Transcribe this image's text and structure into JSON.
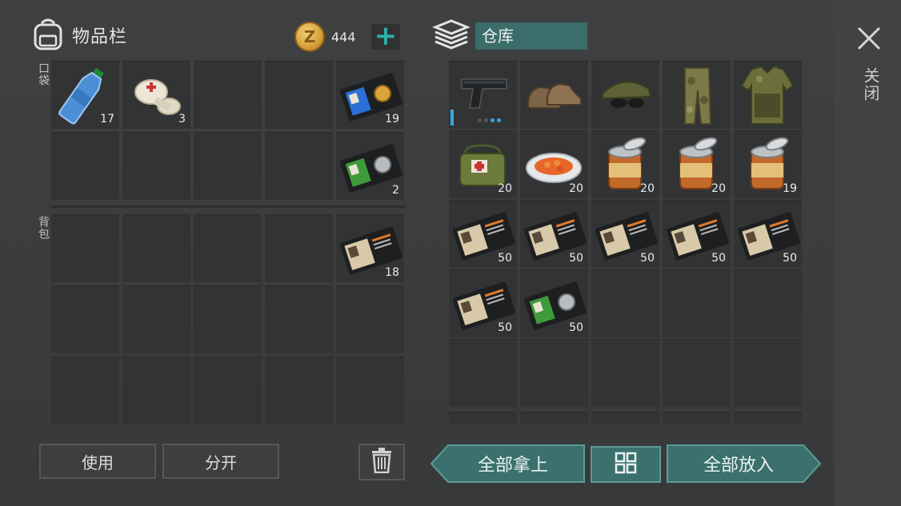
{
  "inventory": {
    "title": "物品栏",
    "coins": "444",
    "add_icon": "plus-icon",
    "pocket_label": "口袋",
    "backpack_label": "背包"
  },
  "storage": {
    "title": "仓库"
  },
  "pocket_slots": [
    {
      "icon": "water-bottle",
      "qty": "17"
    },
    {
      "icon": "bandage",
      "qty": "3"
    },
    {
      "icon": "",
      "qty": ""
    },
    {
      "icon": "",
      "qty": ""
    },
    {
      "icon": "police-badge-blue",
      "qty": "19"
    },
    {
      "icon": "",
      "qty": ""
    },
    {
      "icon": "",
      "qty": ""
    },
    {
      "icon": "",
      "qty": ""
    },
    {
      "icon": "",
      "qty": ""
    },
    {
      "icon": "police-badge-green",
      "qty": "2"
    }
  ],
  "backpack_slots": [
    {
      "icon": "",
      "qty": ""
    },
    {
      "icon": "",
      "qty": ""
    },
    {
      "icon": "",
      "qty": ""
    },
    {
      "icon": "",
      "qty": ""
    },
    {
      "icon": "patrol-officer-id",
      "qty": "18"
    },
    {
      "icon": "",
      "qty": ""
    },
    {
      "icon": "",
      "qty": ""
    },
    {
      "icon": "",
      "qty": ""
    },
    {
      "icon": "",
      "qty": ""
    },
    {
      "icon": "",
      "qty": ""
    },
    {
      "icon": "",
      "qty": ""
    },
    {
      "icon": "",
      "qty": ""
    },
    {
      "icon": "",
      "qty": ""
    },
    {
      "icon": "",
      "qty": ""
    },
    {
      "icon": "",
      "qty": ""
    }
  ],
  "storage_slots": [
    {
      "icon": "pistol",
      "qty": ""
    },
    {
      "icon": "boots",
      "qty": ""
    },
    {
      "icon": "cap-sunglasses",
      "qty": ""
    },
    {
      "icon": "camo-pants",
      "qty": ""
    },
    {
      "icon": "camo-vest",
      "qty": ""
    },
    {
      "icon": "medkit-bag",
      "qty": "20"
    },
    {
      "icon": "carrot-plate",
      "qty": "20"
    },
    {
      "icon": "canned-food",
      "qty": "20"
    },
    {
      "icon": "canned-food",
      "qty": "20"
    },
    {
      "icon": "canned-food",
      "qty": "19"
    },
    {
      "icon": "patrol-officer-id",
      "qty": "50"
    },
    {
      "icon": "patrol-officer-id",
      "qty": "50"
    },
    {
      "icon": "patrol-officer-id",
      "qty": "50"
    },
    {
      "icon": "patrol-officer-id",
      "qty": "50"
    },
    {
      "icon": "patrol-officer-id",
      "qty": "50"
    },
    {
      "icon": "patrol-officer-id",
      "qty": "50"
    },
    {
      "icon": "police-badge-green",
      "qty": "50"
    },
    {
      "icon": "",
      "qty": ""
    },
    {
      "icon": "",
      "qty": ""
    },
    {
      "icon": "",
      "qty": ""
    },
    {
      "icon": "",
      "qty": ""
    },
    {
      "icon": "",
      "qty": ""
    },
    {
      "icon": "",
      "qty": ""
    },
    {
      "icon": "",
      "qty": ""
    },
    {
      "icon": "",
      "qty": ""
    }
  ],
  "buttons": {
    "use": "使用",
    "split": "分开",
    "take_all": "全部拿上",
    "put_all": "全部放入",
    "close": "关闭"
  },
  "colors": {
    "accent": "#3a706d",
    "coin": "#d9a33c"
  }
}
